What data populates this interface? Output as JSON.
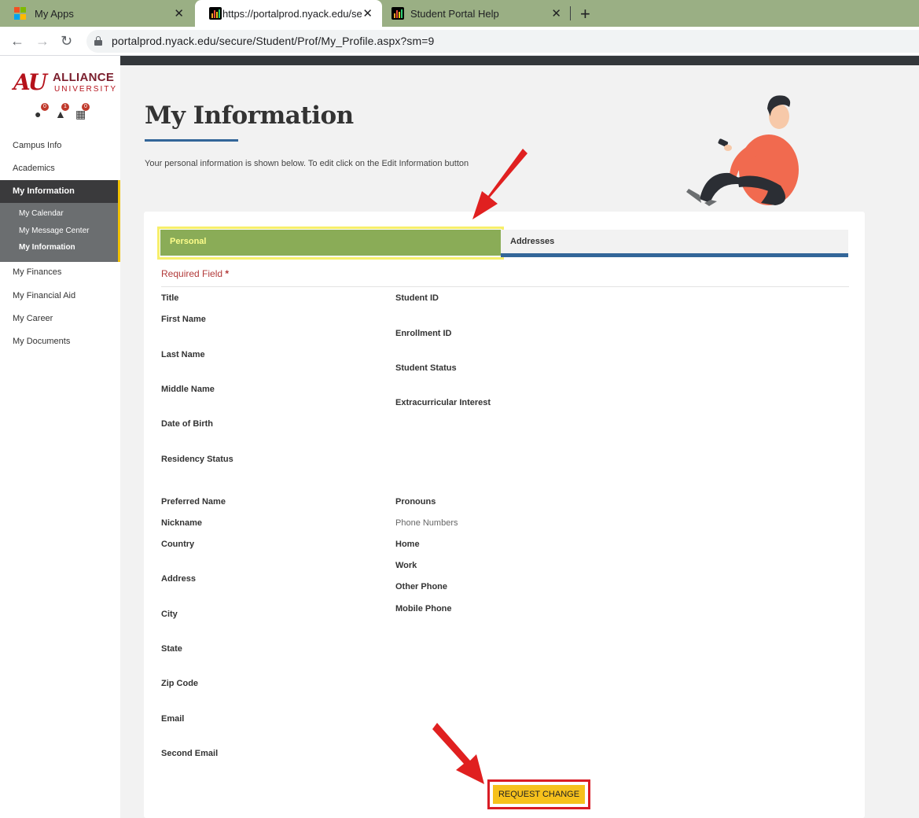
{
  "browser": {
    "tabs": [
      {
        "title": "My Apps",
        "close": "✕"
      },
      {
        "title": "https://portalprod.nyack.edu/sec",
        "close": "✕"
      },
      {
        "title": "Student Portal Help",
        "close": "✕"
      }
    ],
    "new_tab": "+",
    "url": "portalprod.nyack.edu/secure/Student/Prof/My_Profile.aspx?sm=9"
  },
  "logo": {
    "mark": "AU",
    "name": "ALLIANCE",
    "sub": "UNIVERSITY"
  },
  "notifications": [
    {
      "icon": "alert-icon",
      "count": "0"
    },
    {
      "icon": "bell-icon",
      "count": "1"
    },
    {
      "icon": "calendar-icon",
      "count": "0"
    }
  ],
  "sidebar": {
    "items": [
      {
        "label": "Campus Info"
      },
      {
        "label": "Academics"
      },
      {
        "label": "My Information"
      },
      {
        "label": "My Finances"
      },
      {
        "label": "My Financial Aid"
      },
      {
        "label": "My Career"
      },
      {
        "label": "My Documents"
      }
    ],
    "sub_items": [
      {
        "label": "My Calendar"
      },
      {
        "label": "My Message Center"
      },
      {
        "label": "My Information"
      }
    ]
  },
  "main": {
    "title": "My Information",
    "intro": "Your personal information is shown below. To edit click on the Edit Information button",
    "tabs": [
      {
        "label": "Personal"
      },
      {
        "label": "Addresses"
      }
    ],
    "required_label": "Required Field",
    "required_mark": "*",
    "left_fields": [
      "Title",
      "First Name",
      "Last Name",
      "Middle Name",
      "Date of Birth",
      "Residency Status"
    ],
    "right_fields": [
      "Student ID",
      "Enrollment ID",
      "Student Status",
      "Extracurricular Interest"
    ],
    "left_fields_2": [
      "Preferred Name",
      "Nickname",
      "Country",
      "Address",
      "City",
      "State",
      "Zip Code",
      "Email",
      "Second Email"
    ],
    "right_fields_2": [
      "Pronouns",
      "Phone Numbers",
      "Home",
      "Work",
      "Other Phone",
      "Mobile Phone"
    ],
    "request_button": "REQUEST CHANGE"
  },
  "colors": {
    "accent_blue": "#336699",
    "tab_green": "#8aac57",
    "highlight_yellow": "#f7ef6a",
    "button_yellow": "#f6c11c",
    "annotation_red": "#e02020",
    "brand_red": "#b5121b"
  }
}
